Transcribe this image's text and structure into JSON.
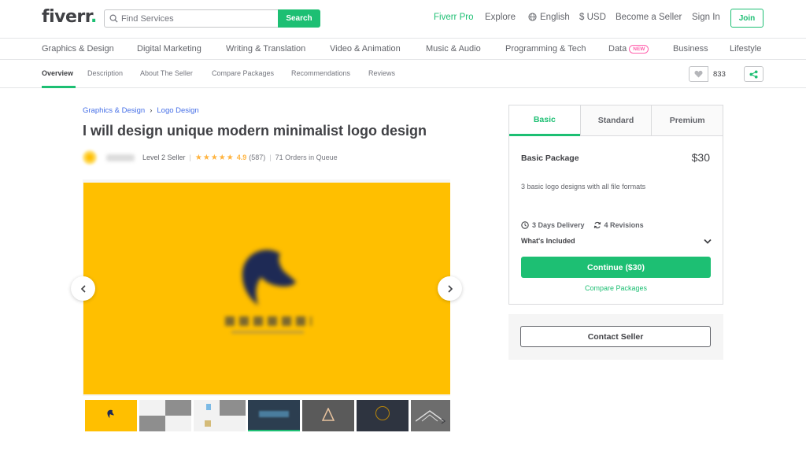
{
  "header": {
    "logo": "fiverr",
    "logo_dot": ".",
    "search_placeholder": "Find Services",
    "search_button": "Search",
    "nav": {
      "pro": "Fiverr Pro",
      "explore": "Explore",
      "language": "English",
      "currency": "$ USD",
      "become_seller": "Become a Seller",
      "sign_in": "Sign In",
      "join": "Join"
    }
  },
  "categories": [
    "Graphics & Design",
    "Digital Marketing",
    "Writing & Translation",
    "Video & Animation",
    "Music & Audio",
    "Programming & Tech",
    "Data",
    "Business",
    "Lifestyle"
  ],
  "new_badge": "NEW",
  "subnav": {
    "tabs": [
      "Overview",
      "Description",
      "About The Seller",
      "Compare Packages",
      "Recommendations",
      "Reviews"
    ],
    "save_count": "833"
  },
  "gig": {
    "breadcrumb": [
      "Graphics & Design",
      "Logo Design"
    ],
    "title": "I will design unique modern minimalist logo design",
    "seller_level": "Level 2 Seller",
    "stars": "★★★★★",
    "rating": "4.9",
    "review_count": "(587)",
    "orders_in_queue": "71 Orders in Queue"
  },
  "package": {
    "tabs": [
      "Basic",
      "Standard",
      "Premium"
    ],
    "active_tab": "Basic",
    "name": "Basic Package",
    "price": "$30",
    "description": "3 basic logo designs with all file formats",
    "delivery": "3 Days Delivery",
    "revisions": "4 Revisions",
    "whats_included": "What's Included",
    "continue_label": "Continue ($30)",
    "compare_label": "Compare Packages"
  },
  "contact": {
    "label": "Contact Seller"
  },
  "colors": {
    "brand_green": "#1dbf73",
    "text_dark": "#404145",
    "link_blue": "#446ee7",
    "star": "#ffb33e",
    "gallery_yellow": "#ffbf00",
    "new_pink": "#ff62ad"
  },
  "icons": [
    "search-icon",
    "globe-icon",
    "heart-icon",
    "share-icon",
    "chevron-left-icon",
    "chevron-right-icon",
    "clock-icon",
    "refresh-icon",
    "chevron-down-icon"
  ]
}
